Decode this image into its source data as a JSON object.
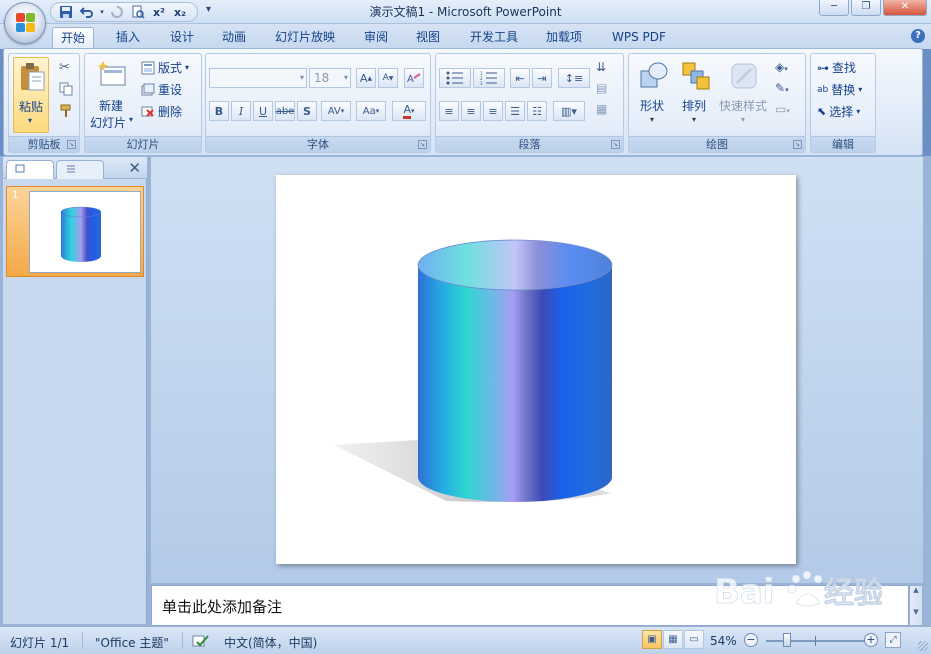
{
  "window": {
    "title": "演示文稿1 - Microsoft PowerPoint"
  },
  "qat": {
    "superscript": "x²",
    "subscript": "x₂"
  },
  "tabs": [
    "开始",
    "插入",
    "设计",
    "动画",
    "幻灯片放映",
    "审阅",
    "视图",
    "开发工具",
    "加载项",
    "WPS PDF"
  ],
  "ribbon": {
    "clipboard": {
      "label": "剪贴板",
      "paste": "粘贴"
    },
    "slides": {
      "label": "幻灯片",
      "new_slide_line1": "新建",
      "new_slide_line2": "幻灯片",
      "layout": "版式",
      "reset": "重设",
      "delete": "删除"
    },
    "font": {
      "label": "字体",
      "font_name": "",
      "font_size": "18",
      "bold": "B",
      "italic": "I",
      "underline": "U",
      "strike": "abe",
      "shadow": "S",
      "spacing": "AV",
      "case": "Aa",
      "color": "A",
      "grow": "A",
      "shrink": "A"
    },
    "paragraph": {
      "label": "段落"
    },
    "drawing": {
      "label": "绘图",
      "shapes": "形状",
      "arrange": "排列",
      "quick_styles": "快速样式"
    },
    "editing": {
      "label": "编辑",
      "find": "查找",
      "replace": "替换",
      "select": "选择"
    }
  },
  "slide_panel": {
    "slide_number": "1"
  },
  "notes": {
    "placeholder": "单击此处添加备注"
  },
  "status": {
    "slide": "幻灯片 1/1",
    "theme": "\"Office 主题\"",
    "language": "中文(简体，中国)",
    "zoom": "54%"
  },
  "colors": {
    "accent": "#15428b",
    "active_thumb": "#f4a947"
  }
}
